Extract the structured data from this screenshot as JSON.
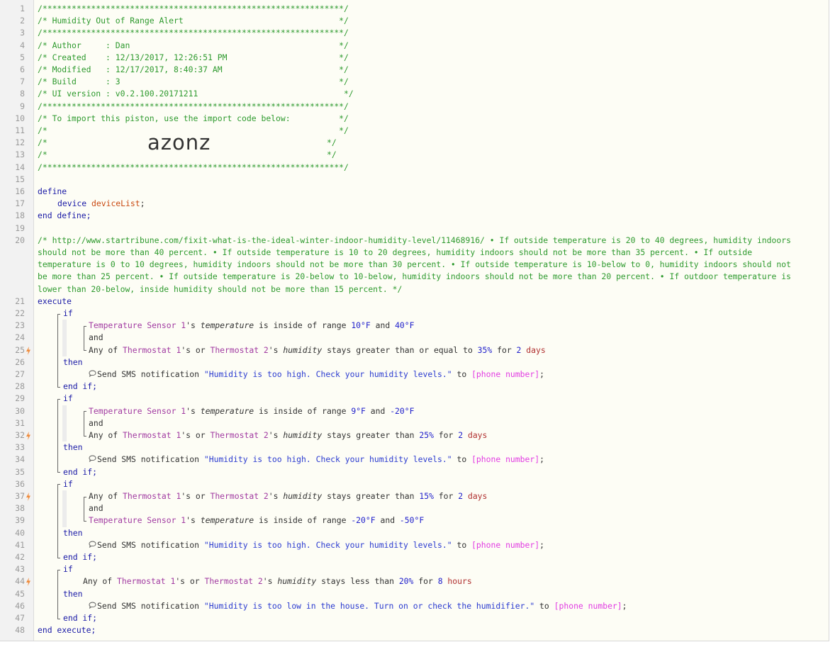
{
  "gutter": {
    "line_numbers": [
      "1",
      "2",
      "3",
      "4",
      "5",
      "6",
      "7",
      "8",
      "9",
      "10",
      "11",
      "12",
      "13",
      "14",
      "15",
      "16",
      "17",
      "18",
      "19",
      "20",
      "21",
      "22",
      "23",
      "24",
      "25",
      "26",
      "27",
      "28",
      "29",
      "30",
      "31",
      "32",
      "33",
      "34",
      "35",
      "36",
      "37",
      "38",
      "39",
      "40",
      "41",
      "42",
      "43",
      "44",
      "45",
      "46",
      "47",
      "48"
    ]
  },
  "header": {
    "stars": "/**************************************************************/",
    "title": "/* Humidity Out of Range Alert                                */",
    "author": "/* Author     : Dan                                           */",
    "created": "/* Created    : 12/13/2017, 12:26:51 PM                       */",
    "modified": "/* Modified   : 12/17/2017, 8:40:37 AM                        */",
    "build": "/* Build      : 3                                             */",
    "ui_version": "/* UI version : v0.2.100.20171211                              */",
    "import_note": "/* To import this piston, use the import code below:          */",
    "blank": "/*                                                            */",
    "blank_left": "/*",
    "blank_right": "*/",
    "import_code": "azonz"
  },
  "define": {
    "open": "define",
    "type": "device",
    "var": "deviceList",
    "semi": ";",
    "close": "end define;"
  },
  "comment": "/* http://www.startribune.com/fixit-what-is-the-ideal-winter-indoor-humidity-level/11468916/ • If outside temperature is 20 to 40 degrees, humidity indoors should not be more than 40 percent. • If outside temperature is 10 to 20 degrees, humidity indoors should not be more than 35 percent. • If outside temperature is 0 to 10 degrees, humidity indoors should not be more than 30 percent. • If outside temperature is 10-below to 0, humidity indoors should not be more than 25 percent. • If outside temperature is 20-below to 10-below, humidity indoors should not be more than 20 percent. • If outdoor temperature is lower than 20-below, inside humidity should not be more than 15 percent. */",
  "code": {
    "execute": "execute",
    "end_execute": "end execute;",
    "if": "if",
    "then": "then",
    "end_if": "end if;",
    "and": "and",
    "dev_temp": "Temperature Sensor 1",
    "dev_th1": "Thermostat 1",
    "dev_th2": "Thermostat 2",
    "poss": "'s",
    "poss_or": "'s or",
    "temperature": "temperature",
    "humidity": "humidity",
    "any_of": "Any of",
    "inside_range": " is inside of range ",
    "stays_ge": " stays greater than or equal to ",
    "stays_gt": " stays greater than ",
    "stays_lt": " stays less than ",
    "for": " for ",
    "send_sms": "Send SMS notification ",
    "to": " to ",
    "semi": ";",
    "msg_high": "\"Humidity is too high. Check your humidity levels.\"",
    "msg_low": "\"Humidity is too low in the house. Turn on or check the humidifier.\"",
    "phone": "[phone number]",
    "b1_lo": "10",
    "b1_hi": "40",
    "b1_pct": "35",
    "b1_dur": "2",
    "b2_lo": "9",
    "b2_hi": "-20",
    "b2_pct": "25",
    "b2_dur": "2",
    "b3_pct": "15",
    "b3_dur": "2",
    "b3_lo": "-20",
    "b3_hi": "-50",
    "b4_pct": "20",
    "b4_dur": "8",
    "deg": "°F",
    "pct": "%",
    "days": "days",
    "hours": "hours",
    "and_sep": " and "
  },
  "colors": {
    "comment": "#2e9a2e",
    "keyword": "#1a1aa6",
    "device": "#a13aa1",
    "variable": "#c94a12",
    "number": "#2222cc",
    "unit": "#b03030",
    "string": "#2b3bd0",
    "phone": "#e23ce2",
    "bolt": "#f08a3a"
  },
  "icons": {
    "trigger": "lightning-bolt-icon",
    "sms": "speech-bubble-icon"
  }
}
